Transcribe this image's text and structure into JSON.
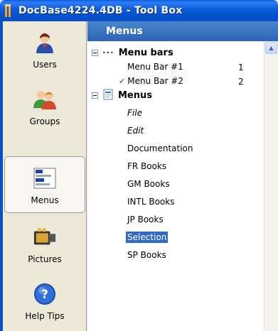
{
  "window": {
    "title": "DocBase4224.4DB - Tool Box",
    "accent": "#0a4fc4"
  },
  "sidebar": {
    "items": [
      {
        "label": "Users",
        "icon": "user-icon"
      },
      {
        "label": "Groups",
        "icon": "group-icon"
      },
      {
        "label": "Menus",
        "icon": "menus-icon",
        "selected": true
      },
      {
        "label": "Pictures",
        "icon": "pictures-icon"
      },
      {
        "label": "Help Tips",
        "icon": "help-icon"
      }
    ]
  },
  "panel": {
    "header": "Menus",
    "tree": {
      "menu_bars": {
        "label": "Menu bars",
        "items": [
          {
            "label": "Menu Bar #1",
            "count": "1"
          },
          {
            "label": "Menu Bar #2",
            "count": "2",
            "checked": true
          }
        ]
      },
      "menus": {
        "label": "Menus",
        "items": [
          {
            "label": "File",
            "italic": true
          },
          {
            "label": "Edit",
            "italic": true
          },
          {
            "label": "Documentation"
          },
          {
            "label": "FR Books"
          },
          {
            "label": "GM Books"
          },
          {
            "label": "INTL Books"
          },
          {
            "label": "JP Books"
          },
          {
            "label": "Selection",
            "selected": true
          },
          {
            "label": "SP Books"
          }
        ]
      }
    }
  },
  "colors": {
    "selection": "#316ac5",
    "header": "#3d74c2"
  }
}
